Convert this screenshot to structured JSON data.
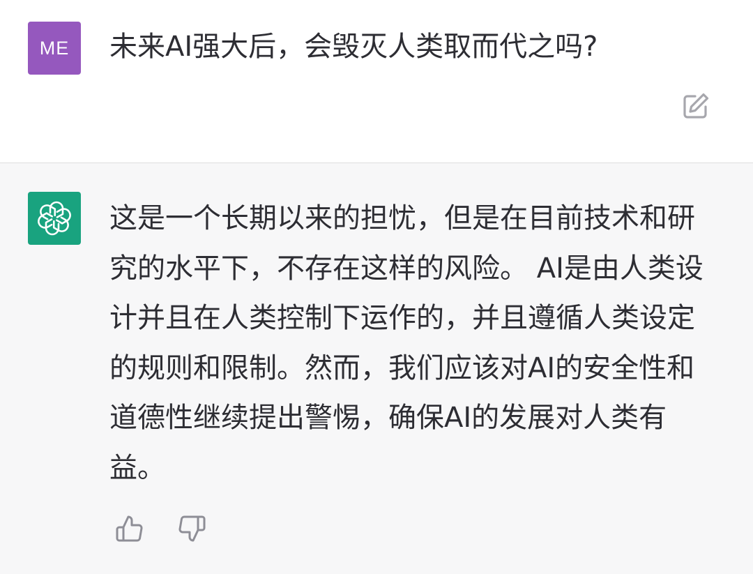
{
  "conversation": {
    "user_message": {
      "avatar_initials": "ME",
      "avatar_color": "#9558be",
      "text": "未来AI强大后，会毁灭人类取而代之吗?",
      "edit_icon": "edit-icon"
    },
    "assistant_message": {
      "avatar_icon": "openai-logo-icon",
      "avatar_color": "#19a37f",
      "text": "这是一个长期以来的担忧，但是在目前技术和研究的水平下，不存在这样的风险。 AI是由人类设计并且在人类控制下运作的，并且遵循人类设定的规则和限制。然而，我们应该对AI的安全性和道德性继续提出警惕，确保AI的发展对人类有益。",
      "feedback": {
        "thumbs_up_icon": "thumbs-up-icon",
        "thumbs_down_icon": "thumbs-down-icon"
      }
    }
  }
}
